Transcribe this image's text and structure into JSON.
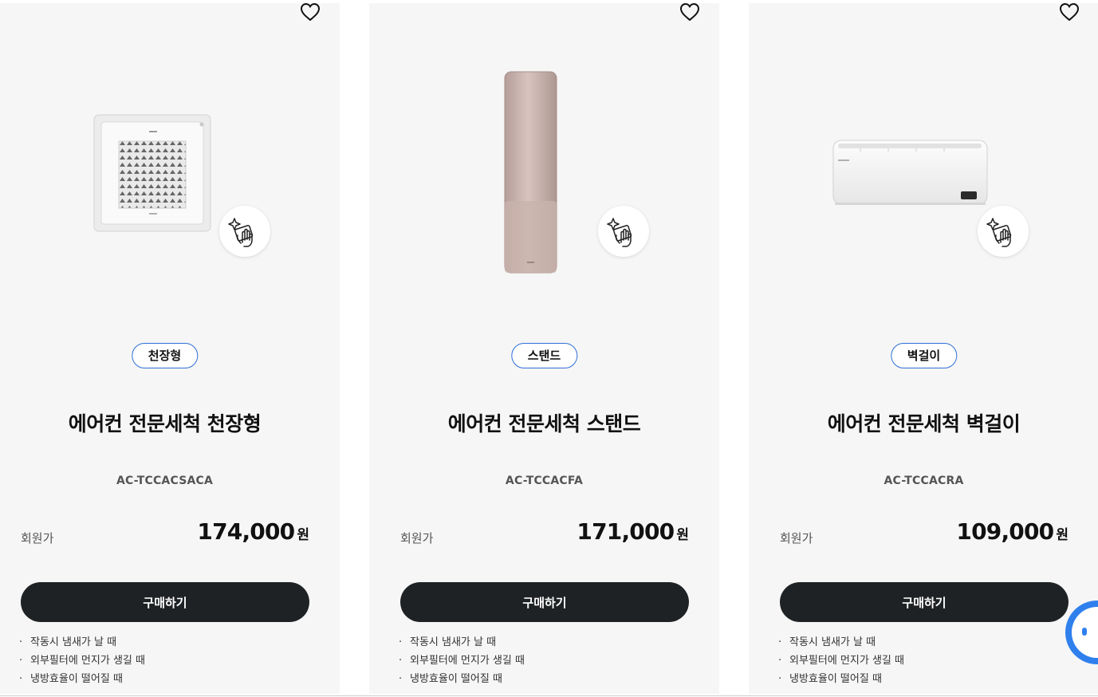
{
  "products": [
    {
      "type_label": "천장형",
      "title": "에어컨 전문세척 천장형",
      "model": "AC-TCCACSACA",
      "price_label": "회원가",
      "price": "174,000",
      "currency": "원",
      "buy_label": "구매하기",
      "notes": [
        "작동시 냄새가 날 때",
        "외부필터에 먼지가 생길 때",
        "냉방효율이 떨어질 때"
      ],
      "image": "ceiling-cassette-aircon",
      "wishlist_icon": "heart-outline-icon",
      "badge_icon": "cleaning-hand-icon"
    },
    {
      "type_label": "스탠드",
      "title": "에어컨 전문세척 스탠드",
      "model": "AC-TCCACFA",
      "price_label": "회원가",
      "price": "171,000",
      "currency": "원",
      "buy_label": "구매하기",
      "notes": [
        "작동시 냄새가 날 때",
        "외부필터에 먼지가 생길 때",
        "냉방효율이 떨어질 때"
      ],
      "image": "stand-aircon",
      "wishlist_icon": "heart-outline-icon",
      "badge_icon": "cleaning-hand-icon"
    },
    {
      "type_label": "벽걸이",
      "title": "에어컨 전문세척 벽걸이",
      "model": "AC-TCCACRA",
      "price_label": "회원가",
      "price": "109,000",
      "currency": "원",
      "buy_label": "구매하기",
      "notes": [
        "작동시 냄새가 날 때",
        "외부필터에 먼지가 생길 때",
        "냉방효율이 떨어질 때"
      ],
      "image": "wall-mount-aircon",
      "wishlist_icon": "heart-outline-icon",
      "badge_icon": "cleaning-hand-icon"
    }
  ],
  "colors": {
    "card_bg": "#f6f6f6",
    "buy_button": "#1f2224",
    "chip_border": "#2d6fd6",
    "chat_button": "#2f80ed"
  },
  "chat_icon": "chatbot-icon"
}
